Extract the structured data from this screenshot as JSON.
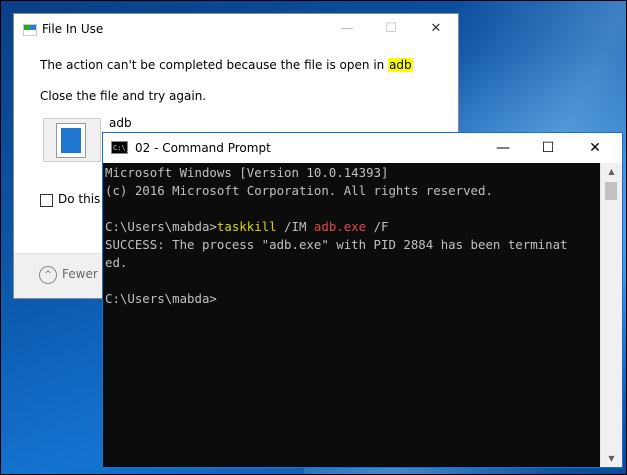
{
  "dialog": {
    "title": "File In Use",
    "minimize_glyph": "—",
    "maximize_glyph": "☐",
    "close_glyph": "✕",
    "message_prefix": "The action can't be completed because the file is open in ",
    "message_app": "adb",
    "message_line2": "Close the file and try again.",
    "file_name": "adb",
    "checkbox_label": "Do this fo",
    "fewer_label": "Fewer d",
    "fewer_glyph": "^"
  },
  "cmd": {
    "title": "02 - Command Prompt",
    "icon_text": "C:\\_",
    "minimize_glyph": "—",
    "maximize_glyph": "☐",
    "close_glyph": "✕",
    "scroll_up_glyph": "▲",
    "scroll_down_glyph": "▼",
    "lines": {
      "l1": "Microsoft Windows [Version 10.0.14393]",
      "l2": "(c) 2016 Microsoft Corporation. All rights reserved.",
      "prompt1": "C:\\Users\\mabda>",
      "cmd_name": "taskkill",
      "cmd_flag1": " /IM ",
      "cmd_arg": "adb.exe",
      "cmd_flag2": " /F",
      "success1": "SUCCESS: The process \"adb.exe\" with PID 2884 has been terminat",
      "success2": "ed.",
      "prompt2": "C:\\Users\\mabda>"
    }
  },
  "colors": {
    "terminal_bg": "#0c0c0c",
    "terminal_text": "#c0c0c0",
    "command_yellow": "#d7d700",
    "argument_red": "#e04848",
    "highlight": "#ffff00",
    "window_border": "#1d6fc9"
  }
}
